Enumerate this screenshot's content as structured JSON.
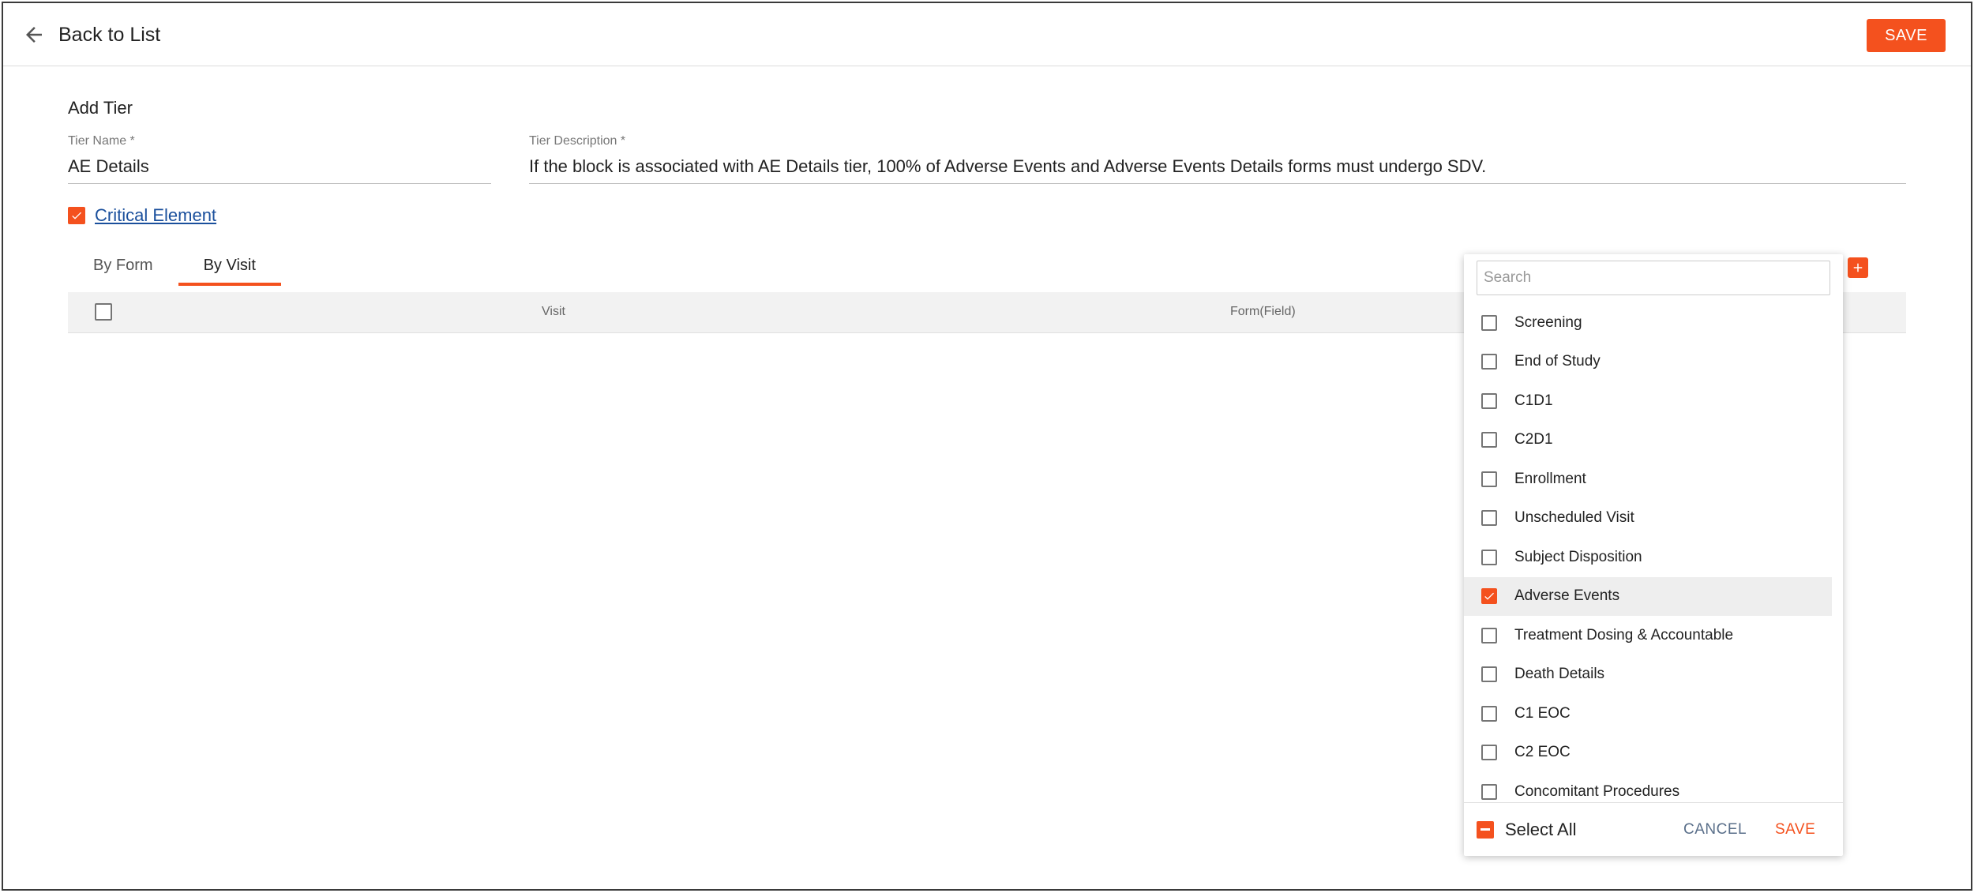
{
  "header": {
    "back_label": "Back to List",
    "save_label": "SAVE"
  },
  "form": {
    "heading": "Add Tier",
    "tier_name_label": "Tier Name *",
    "tier_name_value": "AE Details",
    "tier_description_label": "Tier Description *",
    "tier_description_value": "If the block is associated with AE Details tier, 100% of Adverse Events and Adverse Events Details forms must undergo SDV.",
    "critical_element_label": "Critical Element",
    "critical_element_checked": true
  },
  "tabs": [
    {
      "label": "By Form",
      "active": false
    },
    {
      "label": "By Visit",
      "active": true
    }
  ],
  "table": {
    "columns": [
      "Visit",
      "Form(Field)"
    ]
  },
  "dropdown": {
    "search_placeholder": "Search",
    "options": [
      {
        "label": "Screening",
        "checked": false
      },
      {
        "label": "End of Study",
        "checked": false
      },
      {
        "label": "C1D1",
        "checked": false
      },
      {
        "label": "C2D1",
        "checked": false
      },
      {
        "label": "Enrollment",
        "checked": false
      },
      {
        "label": "Unscheduled Visit",
        "checked": false
      },
      {
        "label": "Subject Disposition",
        "checked": false
      },
      {
        "label": "Adverse Events",
        "checked": true
      },
      {
        "label": "Treatment Dosing & Accountable",
        "checked": false
      },
      {
        "label": "Death Details",
        "checked": false
      },
      {
        "label": "C1 EOC",
        "checked": false
      },
      {
        "label": "C2 EOC",
        "checked": false
      },
      {
        "label": "Concomitant Procedures",
        "checked": false
      }
    ],
    "select_all_label": "Select All",
    "cancel_label": "CANCEL",
    "save_label": "SAVE"
  },
  "colors": {
    "accent": "#f4511e",
    "link": "#1a4f9c"
  }
}
